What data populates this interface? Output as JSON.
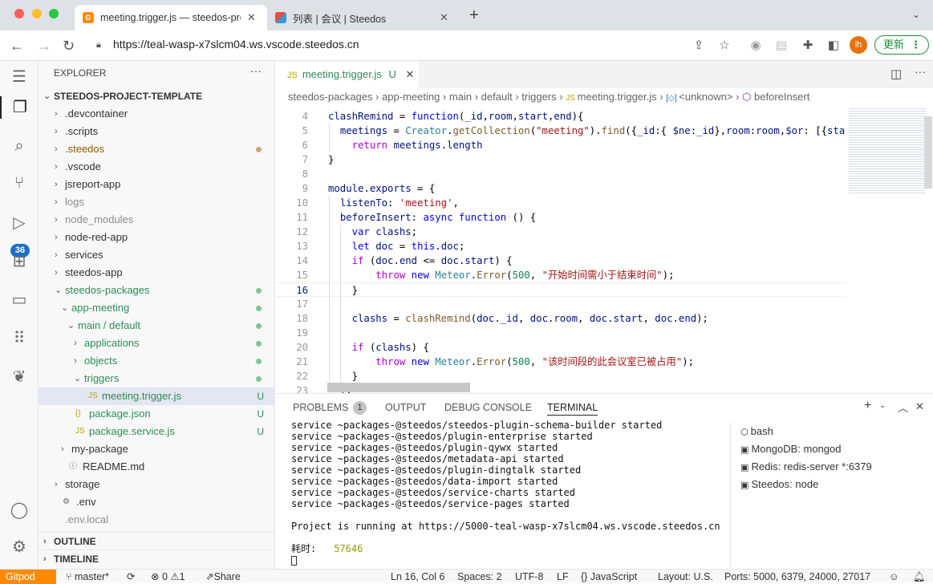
{
  "browser": {
    "tabs": [
      {
        "title": "meeting.trigger.js — steedos-project-template",
        "active": true
      },
      {
        "title": "列表 | 会议 | Steedos",
        "active": false
      }
    ],
    "url": "https://teal-wasp-x7slcm04.ws.vscode.steedos.cn",
    "update_label": "更新",
    "avatar_initials": "lh"
  },
  "activity": {
    "badge": "36"
  },
  "explorer": {
    "title": "EXPLORER",
    "root": "STEEDOS-PROJECT-TEMPLATE",
    "items": [
      {
        "label": ".devcontainer",
        "chev": "›",
        "color": "#333",
        "status": ""
      },
      {
        "label": ".scripts",
        "chev": "›",
        "color": "#333",
        "status": ""
      },
      {
        "label": ".steedos",
        "chev": "›",
        "color": "#8b5a00",
        "status": "dot-brown"
      },
      {
        "label": ".vscode",
        "chev": "›",
        "color": "#333",
        "status": ""
      },
      {
        "label": "jsreport-app",
        "chev": "›",
        "color": "#333",
        "status": ""
      },
      {
        "label": "logs",
        "chev": "›",
        "color": "#8c8c8c",
        "status": ""
      },
      {
        "label": "node_modules",
        "chev": "›",
        "color": "#8c8c8c",
        "status": ""
      },
      {
        "label": "node-red-app",
        "chev": "›",
        "color": "#333",
        "status": ""
      },
      {
        "label": "services",
        "chev": "›",
        "color": "#333",
        "status": ""
      },
      {
        "label": "steedos-app",
        "chev": "›",
        "color": "#333",
        "status": ""
      },
      {
        "label": "steedos-packages",
        "chev": "⌄",
        "color": "#2e8b57",
        "status": "dot-green"
      },
      {
        "label": "app-meeting",
        "chev": "⌄",
        "color": "#2e8b57",
        "status": "dot-green"
      },
      {
        "label": "main / default",
        "chev": "⌄",
        "color": "#2e8b57",
        "status": "dot-green"
      },
      {
        "label": "applications",
        "chev": "›",
        "color": "#2e8b57",
        "status": "dot-green"
      },
      {
        "label": "objects",
        "chev": "›",
        "color": "#2e8b57",
        "status": "dot-green"
      },
      {
        "label": "triggers",
        "chev": "⌄",
        "color": "#2e8b57",
        "status": "dot-green"
      },
      {
        "label": "meeting.trigger.js",
        "chev": "",
        "icon": "JS",
        "color": "#2e8b57",
        "status": "U"
      },
      {
        "label": "package.json",
        "chev": "",
        "icon": "{}",
        "color": "#2e8b57",
        "status": "U"
      },
      {
        "label": "package.service.js",
        "chev": "",
        "icon": "JS",
        "color": "#2e8b57",
        "status": "U"
      },
      {
        "label": "my-package",
        "chev": "›",
        "color": "#333",
        "status": ""
      },
      {
        "label": "README.md",
        "chev": "",
        "icon": "ⓘ",
        "color": "#333",
        "status": ""
      },
      {
        "label": "storage",
        "chev": "›",
        "color": "#333",
        "status": ""
      },
      {
        "label": ".env",
        "chev": "",
        "icon": "⚙",
        "color": "#333",
        "status": ""
      },
      {
        "label": ".env.local",
        "chev": "",
        "icon": "",
        "color": "#8c8c8c",
        "status": ""
      }
    ],
    "outline": "OUTLINE",
    "timeline": "TIMELINE"
  },
  "editor": {
    "tab_label": "meeting.trigger.js",
    "tab_status": "U",
    "breadcrumb": [
      "steedos-packages",
      "app-meeting",
      "main",
      "default",
      "triggers",
      "meeting.trigger.js",
      "<unknown>",
      "beforeInsert"
    ],
    "lines": [
      {
        "n": "4",
        "text": "clashRemind = function(_id,room,start,end){"
      },
      {
        "n": "5",
        "text": "  meetings = Creator.getCollection(\"meeting\").find({_id:{ $ne:_id},room:room,$or: [{start"
      },
      {
        "n": "6",
        "text": "    return meetings.length"
      },
      {
        "n": "7",
        "text": "}"
      },
      {
        "n": "8",
        "text": ""
      },
      {
        "n": "9",
        "text": "module.exports = {"
      },
      {
        "n": "10",
        "text": "  listenTo: 'meeting',"
      },
      {
        "n": "11",
        "text": "  beforeInsert: async function () {"
      },
      {
        "n": "12",
        "text": "    var clashs;"
      },
      {
        "n": "13",
        "text": "    let doc = this.doc;"
      },
      {
        "n": "14",
        "text": "    if (doc.end <= doc.start) {"
      },
      {
        "n": "15",
        "text": "        throw new Meteor.Error(500, \"开始时间需小于结束时间\");"
      },
      {
        "n": "16",
        "text": "    }"
      },
      {
        "n": "17",
        "text": ""
      },
      {
        "n": "18",
        "text": "    clashs = clashRemind(doc._id, doc.room, doc.start, doc.end);"
      },
      {
        "n": "19",
        "text": ""
      },
      {
        "n": "20",
        "text": "    if (clashs) {"
      },
      {
        "n": "21",
        "text": "        throw new Meteor.Error(500, \"该时间段的此会议室已被占用\");"
      },
      {
        "n": "22",
        "text": "    }"
      },
      {
        "n": "23",
        "text": "  },"
      }
    ]
  },
  "panel": {
    "tabs": [
      "PROBLEMS",
      "OUTPUT",
      "DEBUG CONSOLE",
      "TERMINAL"
    ],
    "problems_count": "1",
    "terminal_lines": [
      "service ~packages-@steedos/steedos-plugin-schema-builder started",
      "service ~packages-@steedos/plugin-enterprise started",
      "service ~packages-@steedos/plugin-qywx started",
      "service ~packages-@steedos/metadata-api started",
      "service ~packages-@steedos/plugin-dingtalk started",
      "service ~packages-@steedos/data-import started",
      "service ~packages-@steedos/service-charts started",
      "service ~packages-@steedos/service-pages started",
      "",
      "Project is running at https://5000-teal-wasp-x7slcm04.ws.vscode.steedos.cn",
      ""
    ],
    "elapsed_label": "耗时:",
    "elapsed_value": "57646",
    "terminals": [
      "bash",
      "MongoDB: mongod",
      "Redis: redis-server *:6379",
      "Steedos: node"
    ]
  },
  "statusbar": {
    "gitpod": "Gitpod",
    "branch": "master*",
    "errors": "0",
    "warnings": "1",
    "share": "Share",
    "position": "Ln 16, Col 6",
    "spaces": "Spaces: 2",
    "encoding": "UTF-8",
    "eol": "LF",
    "language": "JavaScript",
    "layout": "Layout: U.S.",
    "ports": "Ports: 5000, 6379, 24000, 27017"
  }
}
